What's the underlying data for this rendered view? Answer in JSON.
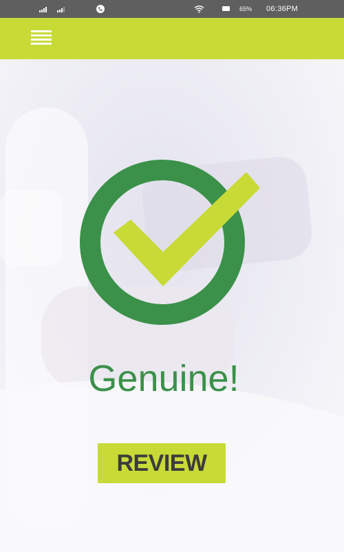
{
  "status_bar": {
    "battery": "65%",
    "time": "06:36PM"
  },
  "icons": {
    "menu": "hamburger-menu-icon",
    "check": "check-circle-icon",
    "signal": "signal-bars-icon",
    "phone": "phone-icon",
    "wifi": "wifi-icon",
    "battery": "battery-icon"
  },
  "result": {
    "title": "Genuine!"
  },
  "actions": {
    "review_label": "REVIEW"
  },
  "colors": {
    "accent_lime": "#c8da36",
    "success_green": "#3b9149",
    "status_bar": "#5f5f5f",
    "button_text": "#3c3c3c"
  }
}
